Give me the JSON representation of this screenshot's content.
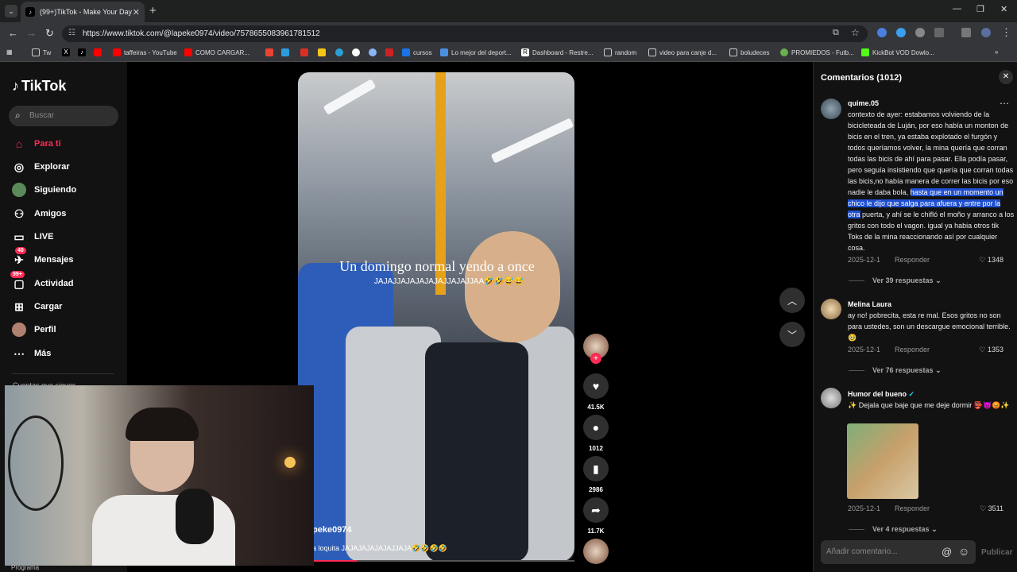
{
  "browser": {
    "tab_title": "(99+)TikTok - Make Your Day",
    "url": "https://www.tiktok.com/@lapeke0974/video/7578655083961781512",
    "bookmarks": [
      "Tw",
      "taffeiras - YouTube",
      "COMO CARGAR...",
      "cursos",
      "Lo mejor del deport...",
      "Dashboard - Restre...",
      "random",
      "video para canje d...",
      "boludeces",
      "PROMIEDOS - Futb...",
      "KickBot VOD Dowlo..."
    ]
  },
  "sidebar": {
    "logo": "TikTok",
    "search_placeholder": "Buscar",
    "items": [
      {
        "label": "Para ti",
        "icon": "home-icon",
        "active": true
      },
      {
        "label": "Explorar",
        "icon": "compass-icon"
      },
      {
        "label": "Siguiendo",
        "icon": "following-avatar-icon"
      },
      {
        "label": "Amigos",
        "icon": "friends-icon"
      },
      {
        "label": "LIVE",
        "icon": "live-icon"
      },
      {
        "label": "Mensajes",
        "icon": "messages-icon",
        "badge": "40"
      },
      {
        "label": "Actividad",
        "icon": "activity-icon",
        "badge": "99+"
      },
      {
        "label": "Cargar",
        "icon": "upload-icon"
      },
      {
        "label": "Perfil",
        "icon": "profile-avatar-icon"
      },
      {
        "label": "Más",
        "icon": "more-icon"
      }
    ],
    "following_label": "Cuentas que sigues"
  },
  "video": {
    "caption_line1": "Un domingo normal yendo a once",
    "caption_line2": "JAJAJJAJAJAJAJAJJAJAJJAA🤣🤣😅😅",
    "author": "lapeke0974",
    "author_visible": "peke0974",
    "description": "a loquita JAJAJAJAJAJAJJAJA🤣🤣🤣🤣",
    "likes": "41.5K",
    "comments": "1012",
    "saves": "2986",
    "shares": "11.7K",
    "progress": 0.17,
    "accent": "#fe2c55"
  },
  "comments_panel": {
    "title": "Comentarios (1012)",
    "comments": [
      {
        "user": "quime.05",
        "text_before": "contexto de ayer: estabamos volviendo de la bicicleteada de Luján, por eso había un monton de bicis en el tren, ya estaba explotado el furgón y todos queríamos volver, la mina quería que corran todas las bicis de ahí para pasar. Ella podía pasar, pero seguía insistiendo que quería que corran todas las bicis,no había manera de correr las bicis por eso nadie le daba bola, ",
        "text_highlight": "hasta que en un momento un chico le dijo que salga para afuera y entre por la otra",
        "text_after": " puerta, y ahí se le chifló el moño y arranco a los gritos con todo el vagon. igual ya habia otros tik Toks de la mina reaccionando así por cualquier cosa.",
        "date": "2025-12-1",
        "reply": "Responder",
        "likes": "1348",
        "replies": "Ver 39 respuestas"
      },
      {
        "user": "Melina Laura",
        "text": "ay no! pobrecita, esta re mal. Esos gritos no son para ustedes, son un descargue emocional terrible. 🥹",
        "date": "2025-12-1",
        "reply": "Responder",
        "likes": "1353",
        "replies": "Ver 76 respuestas"
      },
      {
        "user": "Humor del bueno",
        "verified": "✓",
        "text": "✨ Dejala que baje que me deje dormir 👺😈😡✨",
        "date": "2025-12-1",
        "reply": "Responder",
        "likes": "3511",
        "replies": "Ver 4 respuestas"
      }
    ],
    "input_placeholder": "Añadir comentario...",
    "publish": "Publicar"
  },
  "webcam": {
    "label": "Programa"
  }
}
